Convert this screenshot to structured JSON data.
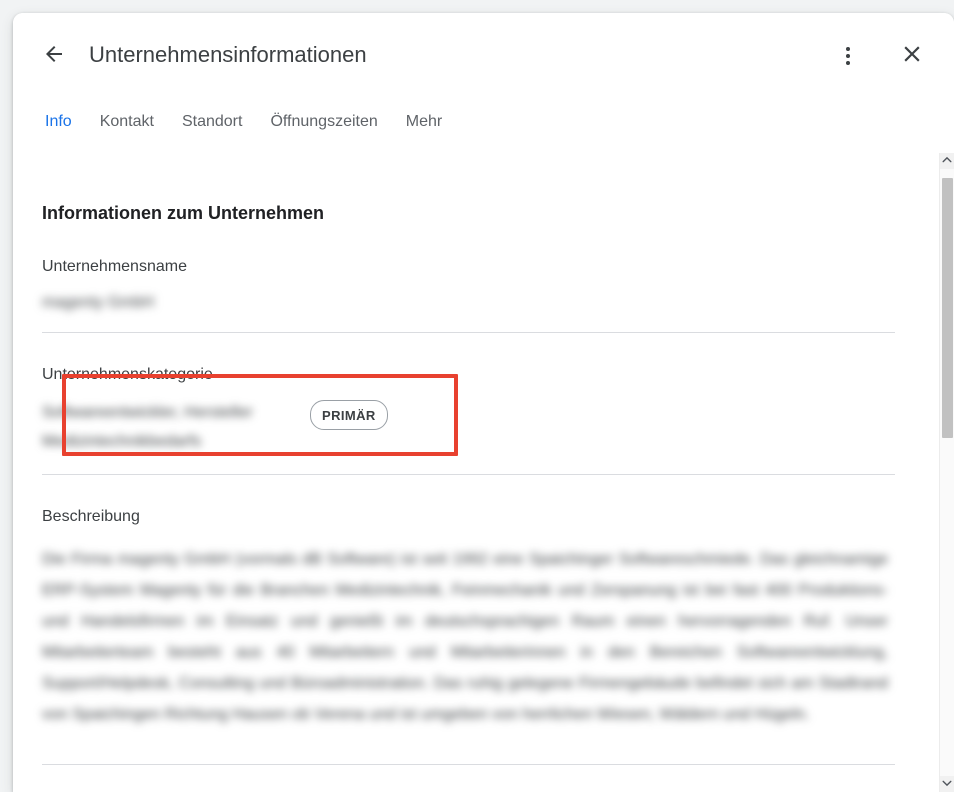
{
  "header": {
    "title": "Unternehmensinformationen",
    "back_icon": "arrow-left-icon",
    "menu_icon": "more-vert-icon",
    "close_icon": "close-icon"
  },
  "tabs": [
    {
      "label": "Info",
      "active": true
    },
    {
      "label": "Kontakt",
      "active": false
    },
    {
      "label": "Standort",
      "active": false
    },
    {
      "label": "Öffnungszeiten",
      "active": false
    },
    {
      "label": "Mehr",
      "active": false
    }
  ],
  "main": {
    "section_title": "Informationen zum Unternehmen",
    "fields": [
      {
        "label": "Unternehmensname",
        "value": "magenty GmbH"
      },
      {
        "label": "Unternehmenskategorie",
        "value": "Softwareentwickler, Hersteller Medizintechnikbedarfs",
        "chip": "PRIMÄR"
      },
      {
        "label": "Beschreibung",
        "value": "Die Firma magenty GmbH (vormals dB Software) ist seit 1992 eine Spaichinger Softwareschmiede. Das gleichnamige ERP-System Magenty für die Branchen Medizintechnik, Feinmechanik und Zerspanung ist bei fast 400 Produktions- und Handelsfirmen im Einsatz und genießt im deutschsprachigen Raum einen hervorragenden Ruf. Unser Mitarbeiterteam besteht aus 40 Mitarbeitern und Mitarbeiterinnen in den Bereichen Softwareentwicklung, Support/Helpdesk, Consulting und Büroadministration. Das ruhig gelegene Firmengebäude befindet sich am Stadtrand von Spaichingen Richtung Hausen ob Verena und ist umgeben von herrlichen Wiesen, Wäldern und Hügeln."
      }
    ]
  },
  "scrollbar": {
    "up_icon": "chevron-up-icon",
    "down_icon": "chevron-down-icon"
  },
  "colors": {
    "accent_blue": "#1a73e8",
    "annotation_red": "#e8412f",
    "text_primary": "#202124",
    "text_secondary": "#3c4043",
    "text_muted": "#5f6368",
    "divider": "#dadce0"
  }
}
